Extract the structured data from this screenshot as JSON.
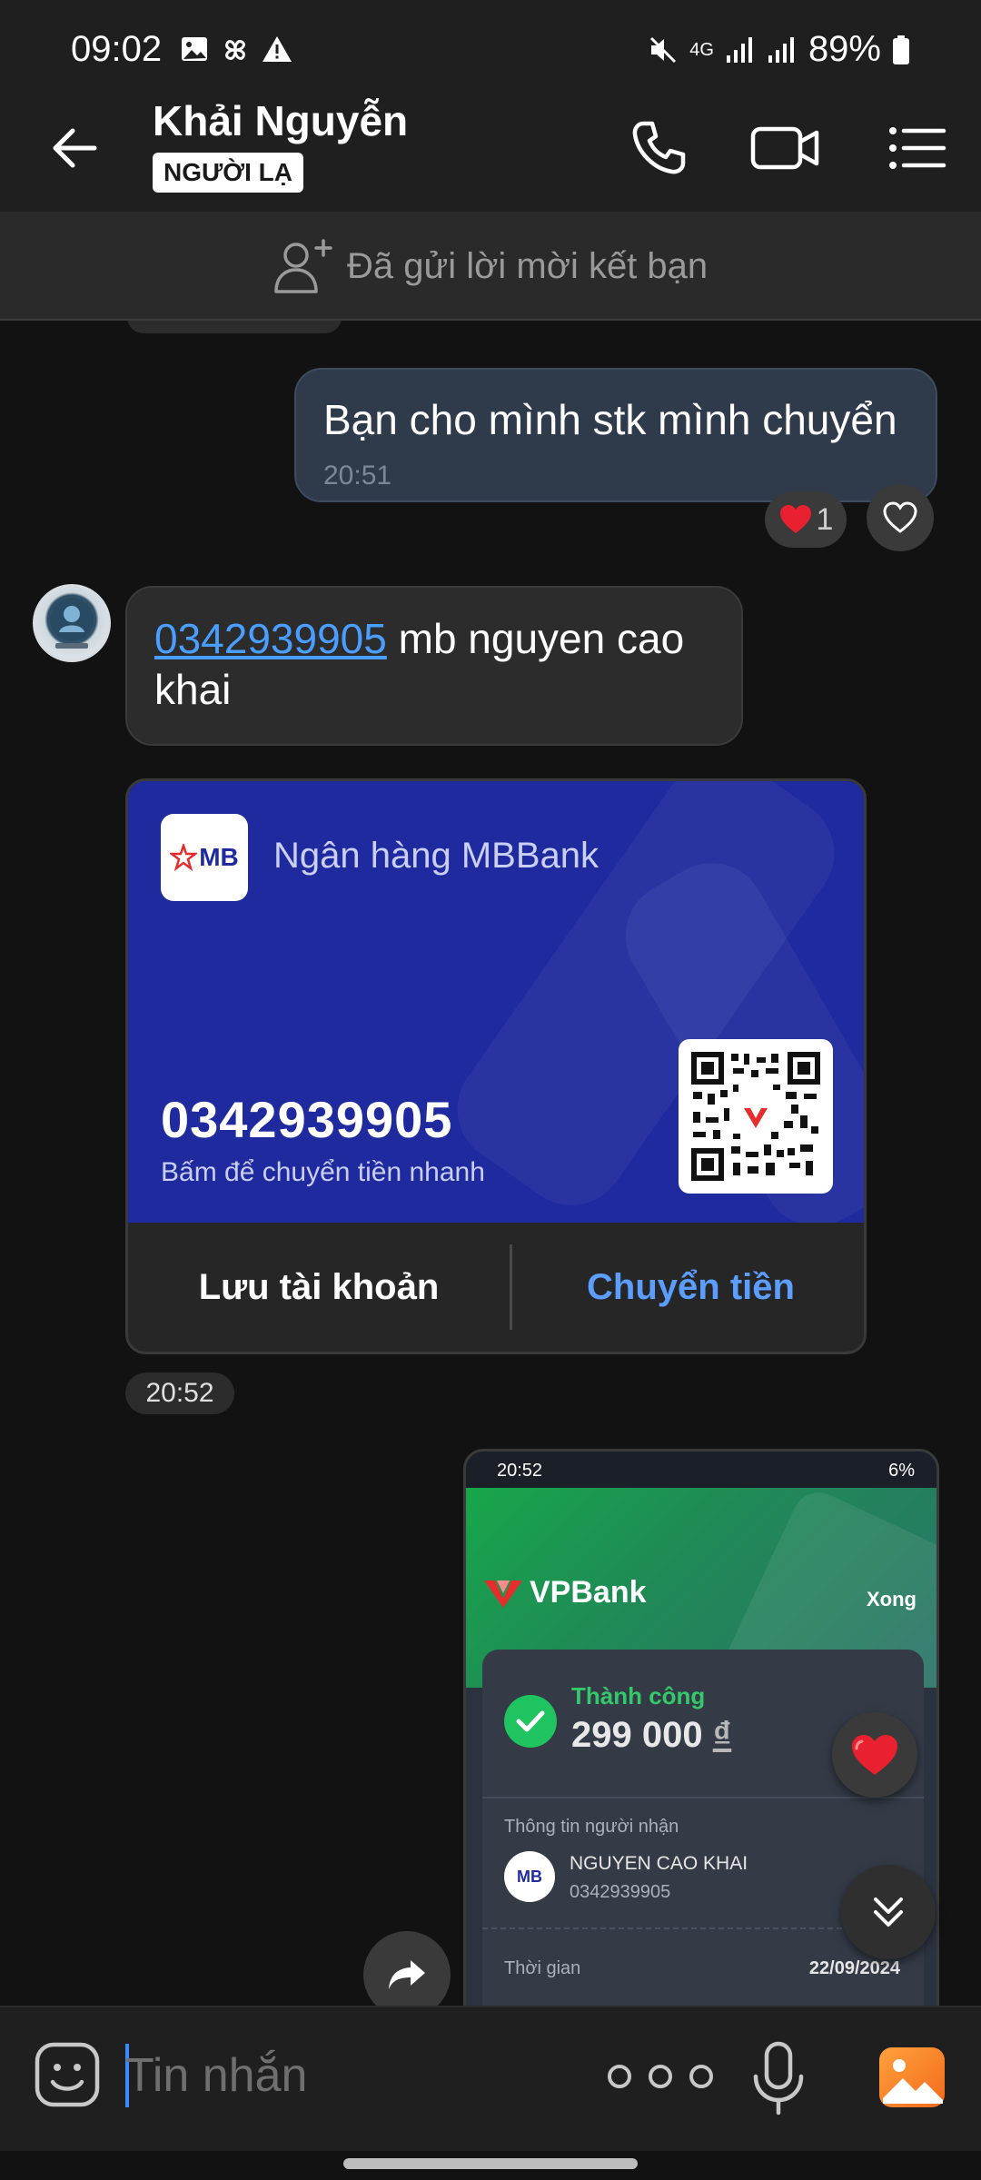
{
  "status_bar": {
    "time": "09:02",
    "network": "4G",
    "battery": "89%",
    "icons": [
      "gallery-icon",
      "pinwheel-icon",
      "warning-icon",
      "mute-icon",
      "signal-icon",
      "battery-icon"
    ]
  },
  "header": {
    "contact_name": "Khải Nguyễn",
    "badge": "NGƯỜI LẠ",
    "icons": [
      "back-arrow-icon",
      "phone-icon",
      "video-camera-icon",
      "list-menu-icon"
    ]
  },
  "friend_request": {
    "text": "Đã gửi lời mời kết bạn",
    "icon": "add-person-icon"
  },
  "messages": {
    "outgoing_1": {
      "text": "Bạn cho mình stk mình chuyển",
      "time": "20:51",
      "reaction_count": "1"
    },
    "incoming_1": {
      "phone": "0342939905",
      "text": " mb nguyen cao khai"
    },
    "bank_card": {
      "logo_text": "MB",
      "bank_name": "Ngân hàng MBBank",
      "account_number": "0342939905",
      "hint": "Bấm để chuyển tiền nhanh",
      "save_button": "Lưu tài khoản",
      "transfer_button": "Chuyển tiền",
      "time": "20:52"
    },
    "screenshot": {
      "status_time": "20:52",
      "status_battery": "6%",
      "bank_brand": "VPBank",
      "done_label": "Xong",
      "success_label": "Thành công",
      "amount": "299 000",
      "currency": "₫",
      "recipient_label": "Thông tin người nhận",
      "recipient_logo": "MB",
      "recipient_name": "NGUYEN CAO KHAI",
      "recipient_account": "0342939905",
      "time_label": "Thời gian",
      "time_value": "22/09/2024"
    }
  },
  "input_bar": {
    "placeholder": "Tin nhắn",
    "icons": [
      "sticker-icon",
      "more-icon",
      "microphone-icon",
      "gallery-icon"
    ]
  },
  "colors": {
    "background": "#121212",
    "header": "#1f1f1f",
    "outgoing_bubble": "#2f3b4b",
    "incoming_bubble": "#2c2c2c",
    "mb_blue": "#1e2a9e",
    "link_blue": "#4a9eff",
    "vp_green": "#17a64a",
    "heart_red": "#e8202f"
  }
}
